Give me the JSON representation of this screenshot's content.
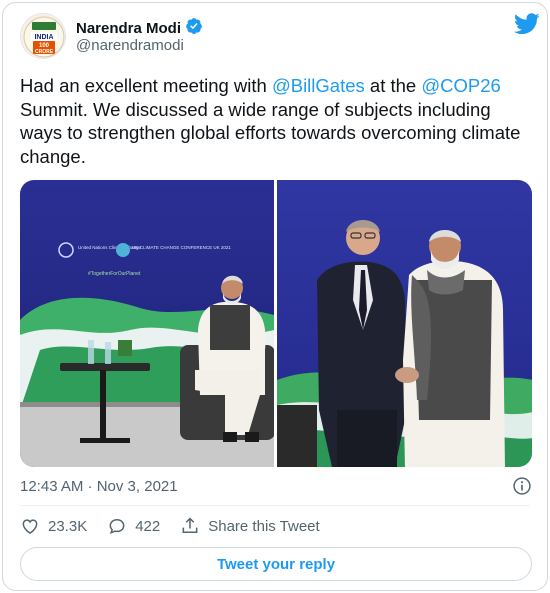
{
  "author": {
    "name": "Narendra Modi",
    "handle": "@narendramodi",
    "verified": true,
    "avatar_text": [
      "INDIA",
      "100",
      "CRORE"
    ]
  },
  "tweet": {
    "text_parts": [
      {
        "text": "Had an excellent meeting with ",
        "mention": false
      },
      {
        "text": "@BillGates",
        "mention": true
      },
      {
        "text": " at the ",
        "mention": false
      },
      {
        "text": "@COP26",
        "mention": true
      },
      {
        "text": " Summit. We discussed a wide range of subjects including ways to strengthen global efforts towards overcoming climate change.",
        "mention": false
      }
    ]
  },
  "media": {
    "photo1_logos": [
      "United Nations Climate Change",
      "UN CLIMATE CHANGE CONFERENCE UK 2021",
      "#TogetherForOurPlanet"
    ]
  },
  "timestamp": "12:43 AM · Nov 3, 2021",
  "stats": {
    "likes": "23.3K",
    "replies": "422",
    "share_label": "Share this Tweet"
  },
  "reply_button_label": "Tweet your reply",
  "colors": {
    "accent": "#1d9bf0",
    "text": "#0f1419",
    "secondary": "#536471",
    "border": "#cfd9de"
  }
}
